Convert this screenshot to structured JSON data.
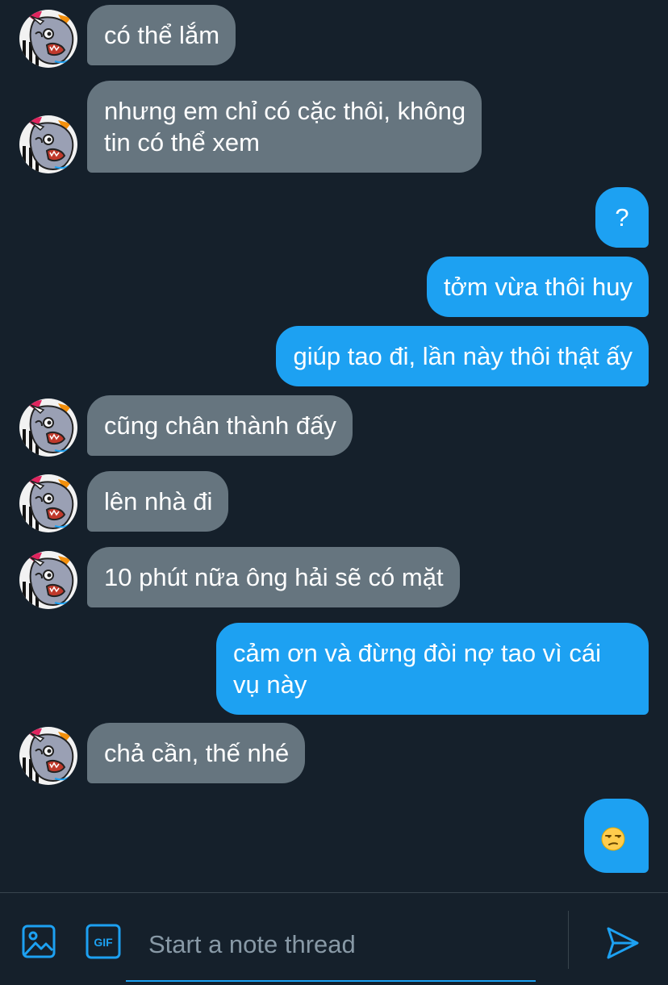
{
  "colors": {
    "background": "#15202b",
    "incoming_bubble": "#66757f",
    "outgoing_bubble": "#1da1f2",
    "accent": "#1da1f2",
    "placeholder": "#8899a6"
  },
  "messages": [
    {
      "direction": "incoming",
      "text": "có thể lắm"
    },
    {
      "direction": "incoming",
      "lines": [
        "nhưng em chỉ có cặc thôi, không",
        "tin có thể xem"
      ]
    },
    {
      "direction": "outgoing",
      "text": "?"
    },
    {
      "direction": "outgoing",
      "text": "tởm vừa thôi huy"
    },
    {
      "direction": "outgoing",
      "text": "giúp tao đi, lần này thôi thật ấy"
    },
    {
      "direction": "incoming",
      "text": "cũng chân thành đấy"
    },
    {
      "direction": "incoming",
      "text": "lên nhà đi"
    },
    {
      "direction": "incoming",
      "text": "10 phút nữa ông hải sẽ có mặt"
    },
    {
      "direction": "outgoing",
      "lines": [
        "cảm ơn và đừng đòi nợ tao vì cái",
        "vụ này"
      ]
    },
    {
      "direction": "incoming",
      "text": "chả cần, thế nhé"
    },
    {
      "direction": "outgoing",
      "emoji": "unamused-face-emoji"
    }
  ],
  "composer": {
    "image_icon": "image-icon",
    "gif_icon": "gif-icon",
    "gif_label": "GIF",
    "placeholder": "Start a note thread",
    "send_icon": "send-icon"
  }
}
